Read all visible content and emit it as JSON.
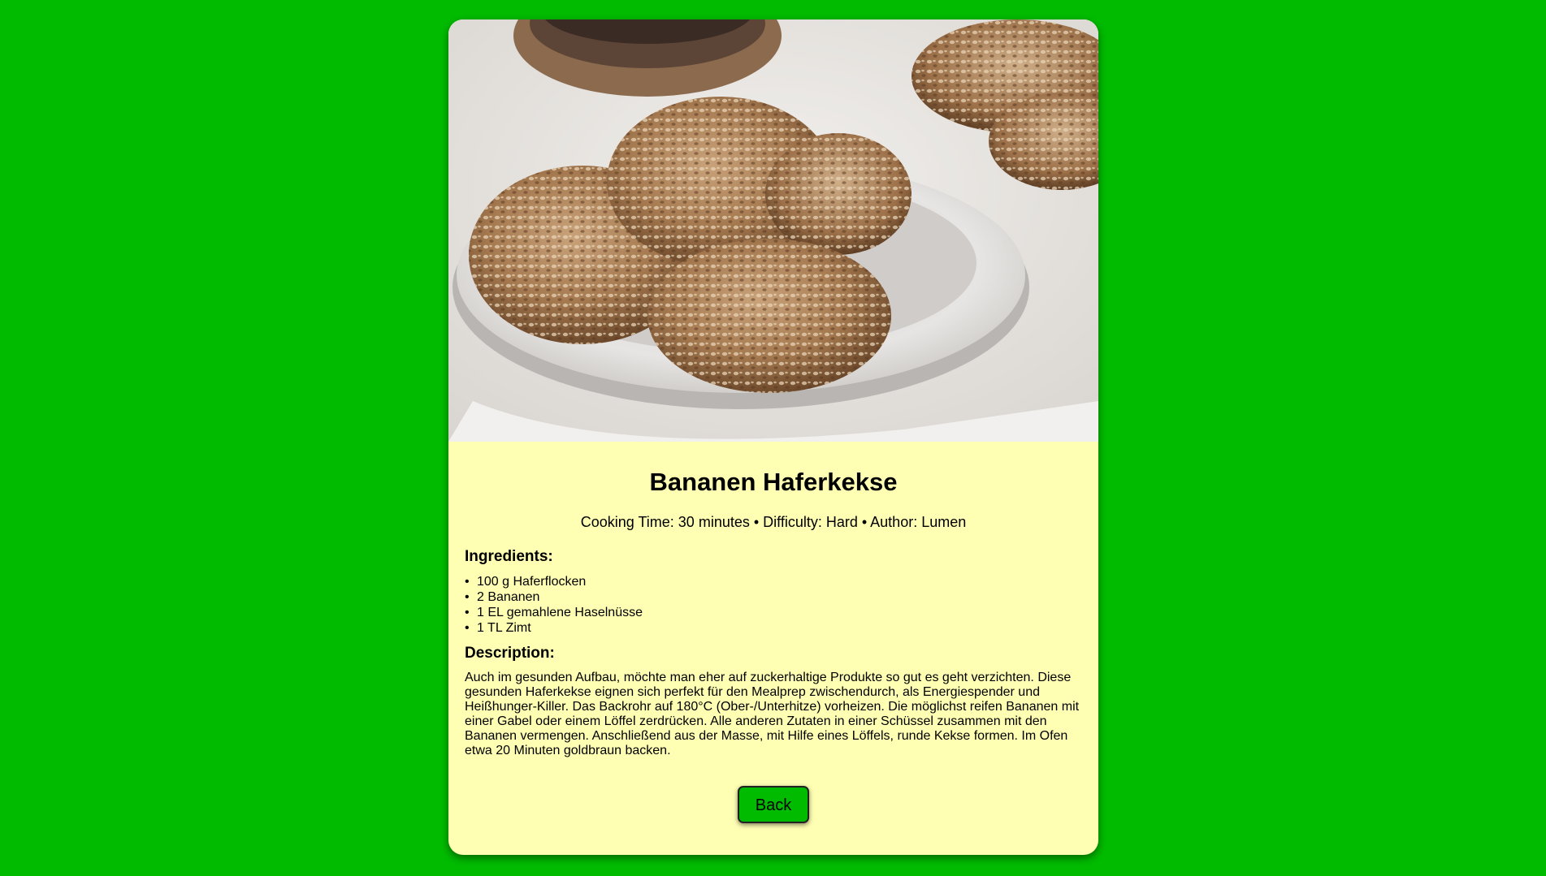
{
  "recipe": {
    "title": "Bananen Haferkekse",
    "meta": "Cooking Time: 30 minutes • Difficulty: Hard • Author: Lumen",
    "photo_alt": "Bananen Haferkekse",
    "ingredients_heading": "Ingredients:",
    "ingredients": [
      "100 g Haferflocken",
      "2 Bananen",
      "1 EL gemahlene Haselnüsse",
      "1 TL Zimt"
    ],
    "bullet": "•",
    "description_heading": "Description:",
    "description": "Auch im gesunden Aufbau, möchte man eher auf zuckerhaltige Produkte so gut es geht verzichten. Diese gesunden Haferkekse eignen sich perfekt für den Mealprep zwischendurch, als Energiespender und Heißhunger-Killer. Das Backrohr auf 180°C (Ober-/Unterhitze) vorheizen. Die möglichst reifen Bananen mit einer Gabel oder einem Löffel zerdrücken. Alle anderen Zutaten in einer Schüssel zusammen mit den Bananen vermengen. Anschließend aus der Masse, mit Hilfe eines Löffels, runde Kekse formen. Im Ofen etwa 20 Minuten goldbraun backen."
  },
  "actions": {
    "back_label": "Back"
  },
  "colors": {
    "page_background": "#00bb00",
    "card_background": "#ffffb4",
    "button_background": "#00bb00"
  }
}
